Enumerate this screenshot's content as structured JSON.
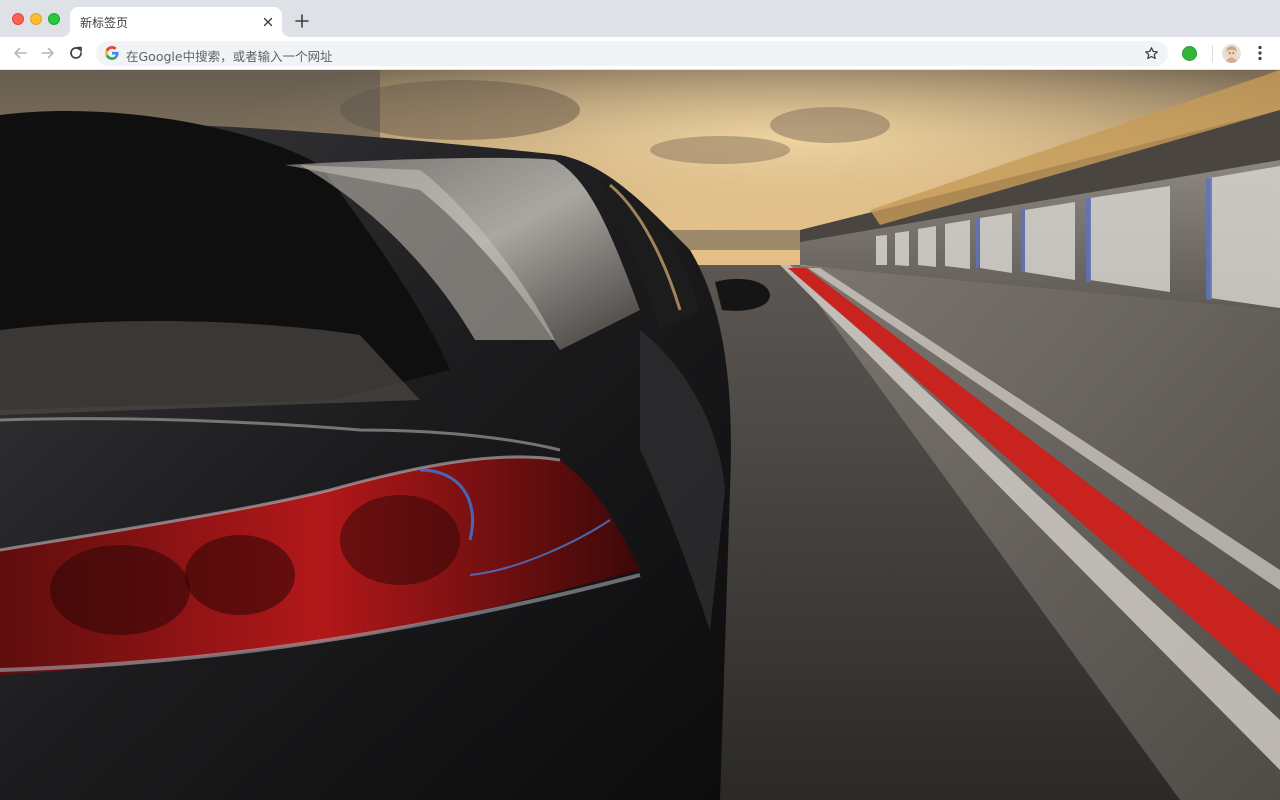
{
  "window": {
    "controls": [
      "close",
      "minimize",
      "maximize"
    ]
  },
  "tabs": [
    {
      "title": "新标签页",
      "active": true
    }
  ],
  "toolbar": {
    "omnibox_placeholder": "在Google中搜索，或者输入一个网址"
  },
  "icons": {
    "back": "arrow-left-icon",
    "forward": "arrow-right-icon",
    "reload": "reload-icon",
    "search_engine": "google-g-icon",
    "bookmark": "star-icon",
    "extension": "green-circle-extension-icon",
    "profile": "avatar-icon",
    "menu": "vertical-dots-icon",
    "new_tab": "plus-icon",
    "tab_close": "close-icon"
  },
  "colors": {
    "tabstrip_bg": "#dee1e6",
    "toolbar_bg": "#ffffff",
    "omnibox_bg": "#f1f3f4",
    "track_stripe": "#c8231f"
  }
}
